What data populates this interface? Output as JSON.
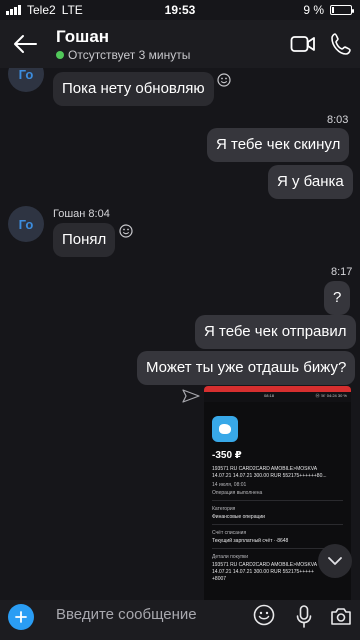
{
  "status_bar": {
    "carrier": "Tele2",
    "network": "LTE",
    "time": "19:53",
    "battery_text": "9 %",
    "battery_level": 0.09
  },
  "header": {
    "name": "Гошан",
    "status": "Отсутствует 3 минуты",
    "presence_color": "#51c85a"
  },
  "chat": {
    "avatar_initials": "Го",
    "messages": [
      {
        "text": "Пока нету обновляю"
      },
      {
        "time": "8:03"
      },
      {
        "text": "Я тебе чек скинул"
      },
      {
        "text": "Я у банка"
      },
      {
        "sender": "Гошан",
        "time": "8:04"
      },
      {
        "text": "Понял"
      },
      {
        "time": "8:17"
      },
      {
        "text": "?"
      },
      {
        "text": "Я тебе чек отправил"
      },
      {
        "text": "Может ты уже отдашь бижу?"
      }
    ]
  },
  "receipt": {
    "status_time": "08:18",
    "status_right": "Ⓜ ☏ 04:24 30 %",
    "amount": "-350 ₽",
    "lines": [
      "193571 RU CARD2CARD AMOBILE>MOSKVA",
      "14.07.21 14.07.21 300.00 RUR 552175++++++80...",
      "14 июля, 08:01",
      "Операция выполнена",
      "Категория",
      "Финансовые операции",
      "Счёт списания",
      "Текущий зарплатный счёт ··8648",
      "Детали покупки",
      "193571 RU CARD2CARD AMOBILE>MOSKVA",
      "14.07.21 14.07.21 300.00 RUR 552175+++++",
      "+8007"
    ]
  },
  "input": {
    "placeholder": "Введите сообщение"
  },
  "colors": {
    "accent": "#2a9df4",
    "background": "#16161a",
    "bubble_in": "#2b2b30",
    "bubble_out": "#36363c"
  }
}
